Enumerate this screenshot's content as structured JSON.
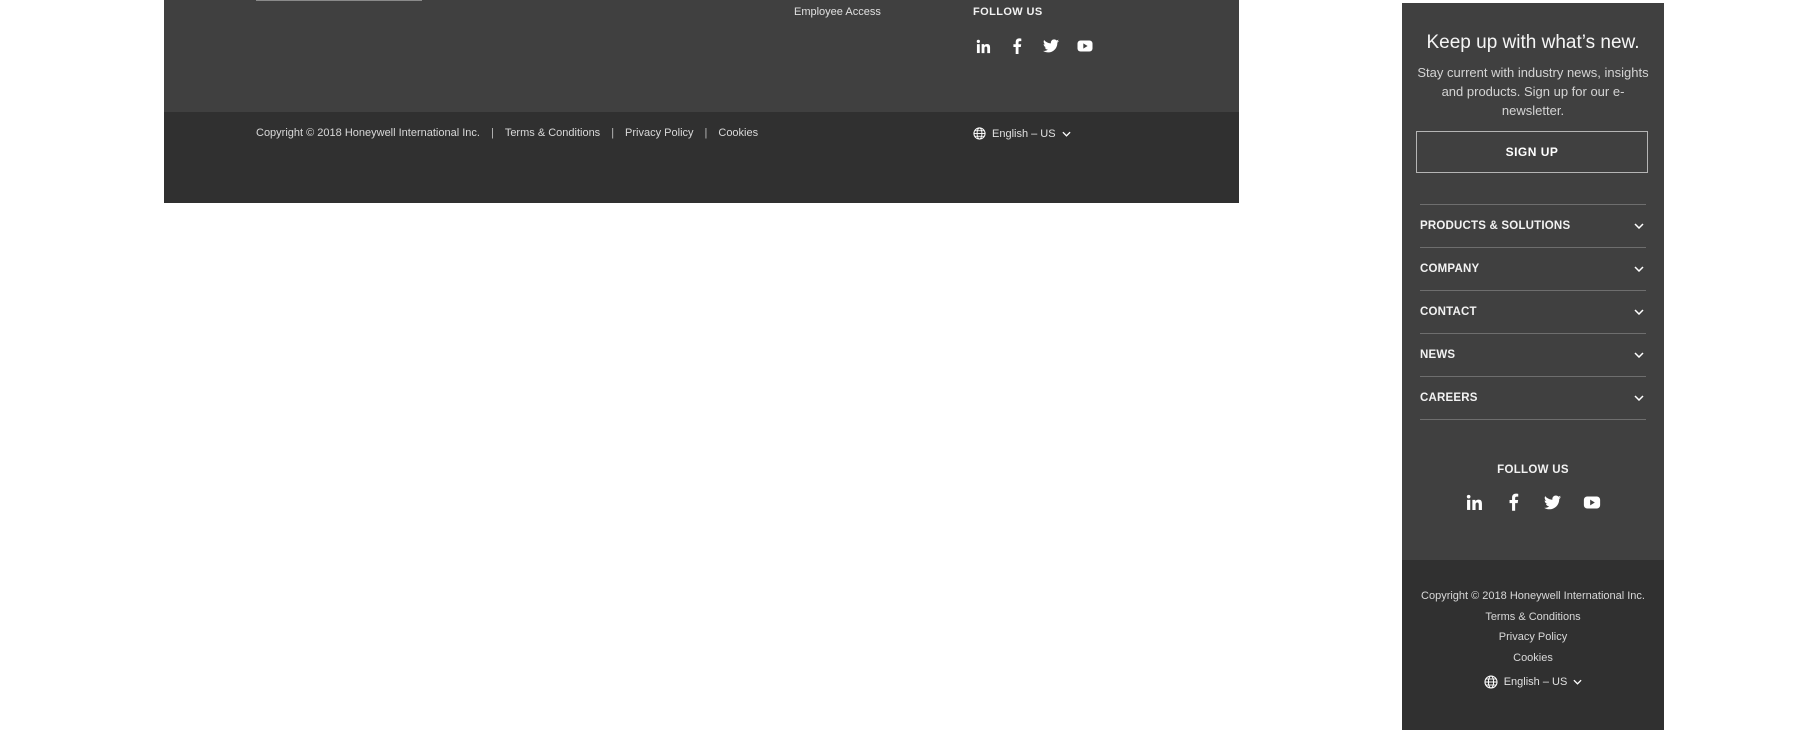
{
  "desktop_footer": {
    "employee_access": "Employee Access",
    "follow_us": "FOLLOW US",
    "social": [
      "linkedin-icon",
      "facebook-icon",
      "twitter-icon",
      "youtube-icon"
    ],
    "copyright": "Copyright © 2018 Honeywell International Inc.",
    "separator": "|",
    "terms": "Terms & Conditions",
    "privacy": "Privacy Policy",
    "cookies": "Cookies",
    "language": "English – US"
  },
  "mobile_footer": {
    "heading": "Keep up with what’s new.",
    "description": "Stay current with industry news, insights and products. Sign up for our e-newsletter.",
    "signup_label": "SIGN UP",
    "accordion": [
      {
        "label": "PRODUCTS & SOLUTIONS"
      },
      {
        "label": "COMPANY"
      },
      {
        "label": "CONTACT"
      },
      {
        "label": "NEWS"
      },
      {
        "label": "CAREERS"
      }
    ],
    "follow_us": "FOLLOW US",
    "copyright": "Copyright © 2018 Honeywell International Inc.",
    "terms": "Terms & Conditions",
    "privacy": "Privacy Policy",
    "cookies": "Cookies",
    "language": "English – US"
  },
  "colors": {
    "footer_upper": "#404040",
    "footer_lower": "#303030",
    "text": "#ffffff"
  }
}
